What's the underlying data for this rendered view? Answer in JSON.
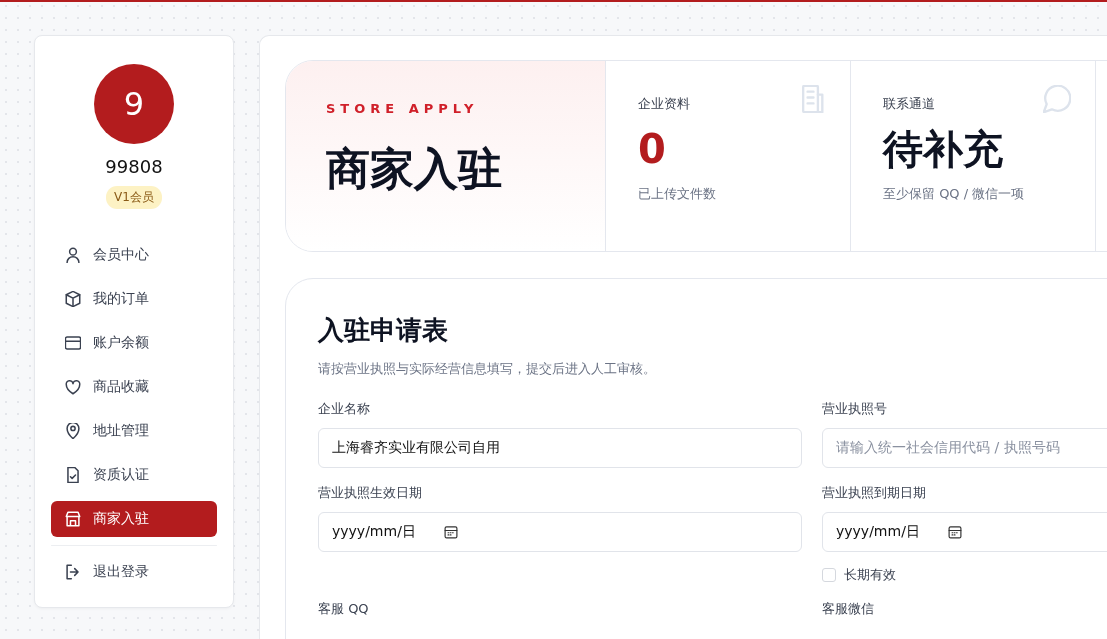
{
  "sidebar": {
    "avatar": "9",
    "username": "99808",
    "badge": "V1会员",
    "items": [
      {
        "label": "会员中心",
        "selected": false
      },
      {
        "label": "我的订单",
        "selected": false
      },
      {
        "label": "账户余额",
        "selected": false
      },
      {
        "label": "商品收藏",
        "selected": false
      },
      {
        "label": "地址管理",
        "selected": false
      },
      {
        "label": "资质认证",
        "selected": false
      },
      {
        "label": "商家入驻",
        "selected": true
      }
    ],
    "logout": "退出登录"
  },
  "hero": {
    "eyebrow": "STORE APPLY",
    "title": "商家入驻",
    "stats": [
      {
        "label": "企业资料",
        "value": "0",
        "note": "已上传文件数",
        "accent": true
      },
      {
        "label": "联系通道",
        "value": "待补充",
        "note": "至少保留 QQ / 微信一项",
        "accent": false
      }
    ]
  },
  "form": {
    "title": "入驻申请表",
    "subtitle": "请按营业执照与实际经营信息填写，提交后进入人工审核。",
    "fields": [
      {
        "label": "企业名称",
        "kind": "text",
        "value": "上海睿齐实业有限公司自用"
      },
      {
        "label": "营业执照号",
        "kind": "text",
        "placeholder": "请输入统一社会信用代码 / 执照号码"
      },
      {
        "label": "营业执照生效日期",
        "kind": "date",
        "placeholder": "yyyy/mm/日"
      },
      {
        "label": "营业执照到期日期",
        "kind": "date",
        "placeholder": "yyyy/mm/日",
        "checkbox": {
          "label": "长期有效",
          "checked": false
        }
      },
      {
        "label": "客服 QQ",
        "kind": "label"
      },
      {
        "label": "客服微信",
        "kind": "label"
      }
    ]
  }
}
